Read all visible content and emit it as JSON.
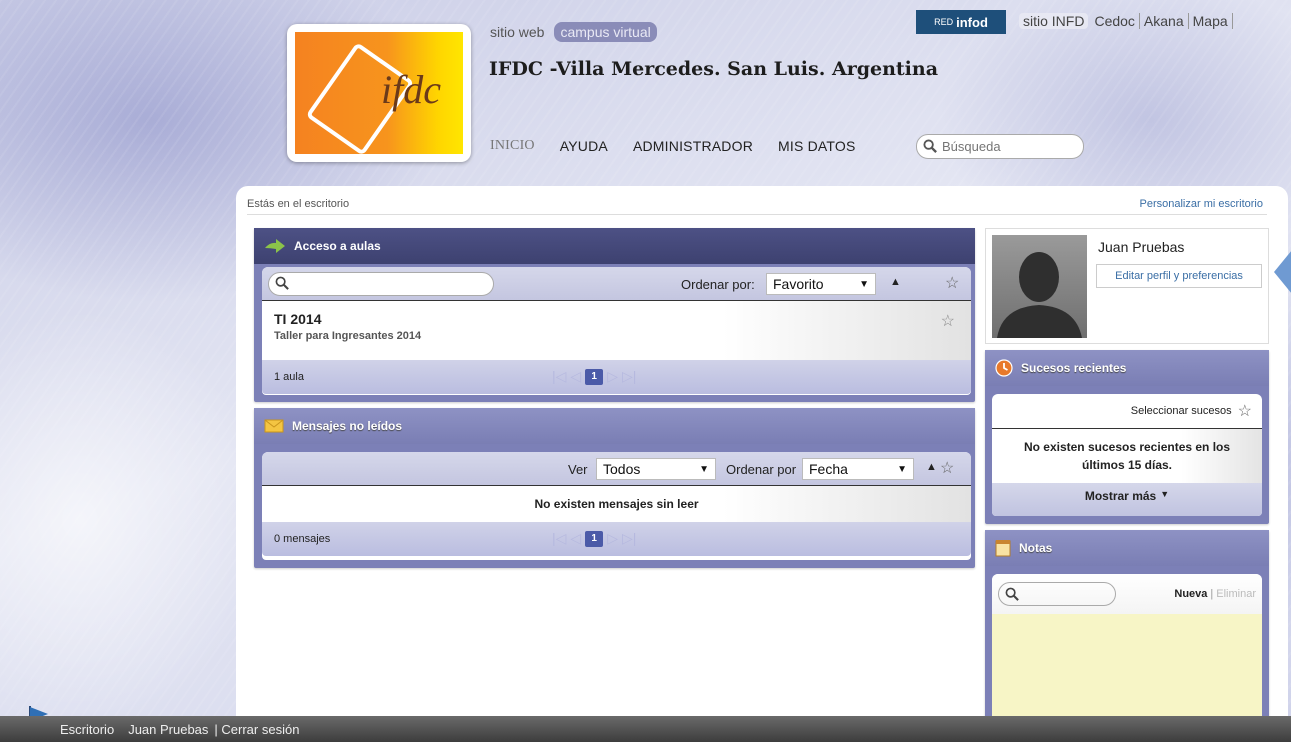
{
  "header": {
    "site_switch": [
      "sitio web",
      "campus virtual"
    ],
    "site_title": "IFDC -Villa Mercedes. San Luis. Argentina",
    "nav": [
      "INICIO",
      "AYUDA",
      "ADMINISTRADOR",
      "MIS DATOS"
    ],
    "search_placeholder": "Búsqueda",
    "red_small": "RED",
    "red_big": "infod",
    "toplinks": [
      "sitio INFD",
      "Cedoc",
      "Akana",
      "Mapa"
    ]
  },
  "breadcrumb": "Estás en el escritorio",
  "personalize": "Personalizar mi escritorio",
  "aulas": {
    "title": "Acceso a aulas",
    "order_label": "Ordenar por:",
    "order_value": "Favorito",
    "item_title": "TI 2014",
    "item_subtitle": "Taller para Ingresantes 2014",
    "count": "1 aula",
    "page": "1"
  },
  "mensajes": {
    "title": "Mensajes no leídos",
    "ver_label": "Ver",
    "ver_value": "Todos",
    "order_label": "Ordenar por",
    "order_value": "Fecha",
    "empty": "No existen mensajes sin leer",
    "count": "0 mensajes",
    "page": "1"
  },
  "profile": {
    "name": "Juan Pruebas",
    "edit": "Editar perfil y preferencias"
  },
  "sucesos": {
    "title": "Sucesos recientes",
    "select": "Seleccionar sucesos",
    "empty": "No existen sucesos recientes en los últimos 15 días.",
    "more": "Mostrar más"
  },
  "notas": {
    "title": "Notas",
    "new": "Nueva",
    "delete": "Eliminar"
  },
  "bottom": {
    "escritorio": "Escritorio",
    "user": "Juan Pruebas",
    "logout": "| Cerrar sesión"
  },
  "colors": {
    "panel_dark": "#3d4170",
    "panel_mid": "#7c80b7",
    "accent_red_infod": "#1e4f7a",
    "notes_yellow": "#f7f5c6"
  }
}
